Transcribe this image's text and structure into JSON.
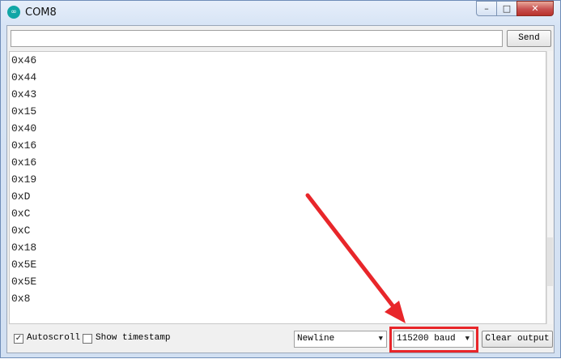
{
  "window": {
    "title": "COM8",
    "app_icon": "arduino-logo-icon",
    "app_icon_glyph": "∞",
    "controls": {
      "minimize": "–",
      "maximize": "□",
      "close": "✕"
    }
  },
  "send_bar": {
    "input_value": "",
    "send_label": "Send"
  },
  "output": {
    "lines": [
      "0x46",
      "0x44",
      "0x43",
      "0x15",
      "0x40",
      "0x16",
      "0x16",
      "0x19",
      "0xD",
      "0xC",
      "0xC",
      "0x18",
      "0x5E",
      "0x5E",
      "0x8"
    ]
  },
  "status_bar": {
    "autoscroll": {
      "label": "Autoscroll",
      "checked": true,
      "mark": "✓"
    },
    "timestamp": {
      "label": "Show timestamp",
      "checked": false
    },
    "line_ending": {
      "selected": "Newline"
    },
    "baud": {
      "selected": "115200 baud"
    },
    "clear_label": "Clear output"
  },
  "annotation": {
    "color": "#e8262a"
  }
}
